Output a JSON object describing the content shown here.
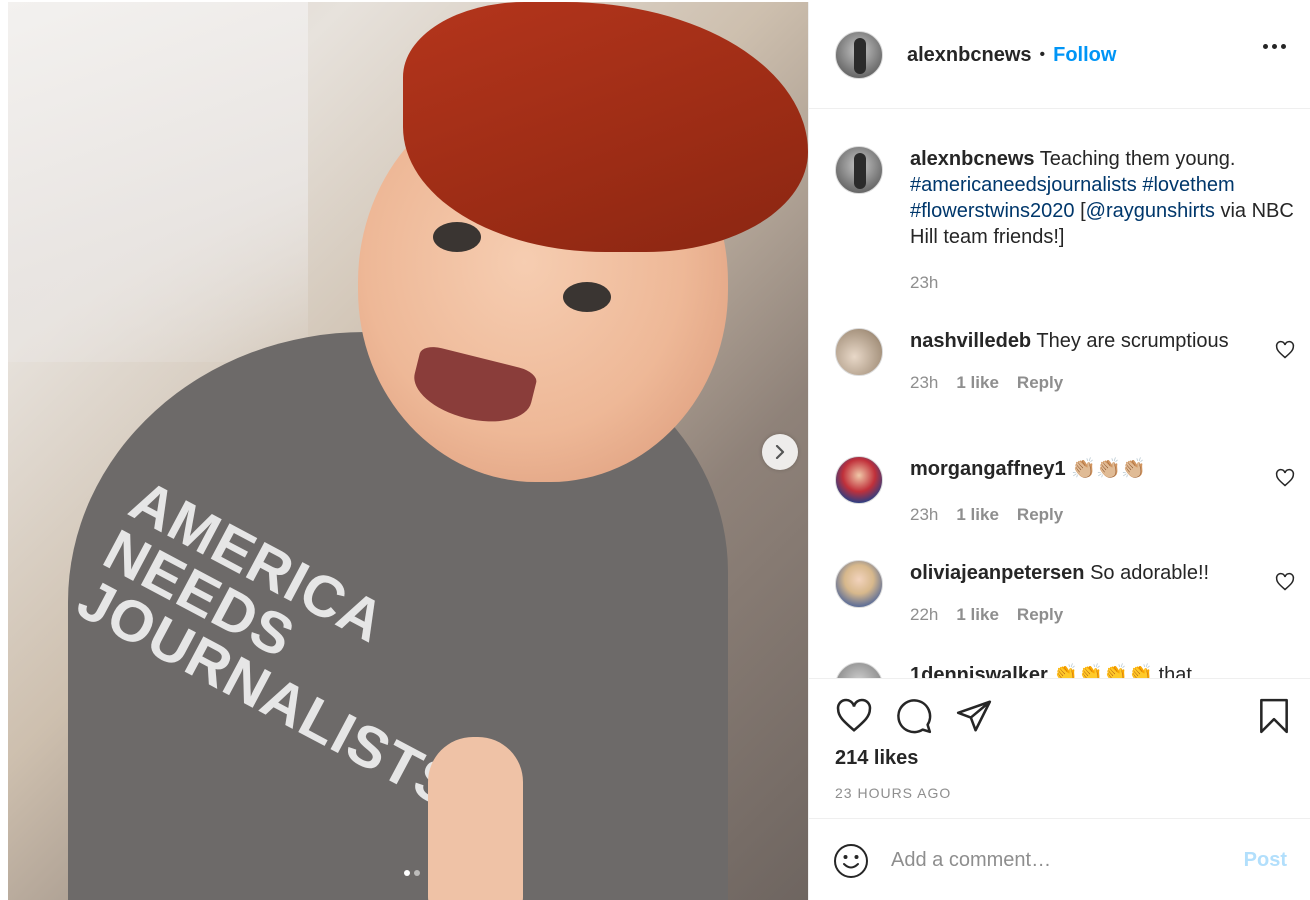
{
  "photo": {
    "shirt_print": [
      "AMERICA",
      "NEEDS",
      "JOURNALISTS"
    ],
    "carousel_dots": 2,
    "active_dot": 0
  },
  "header": {
    "username": "alexnbcnews",
    "separator": "•",
    "follow_label": "Follow"
  },
  "caption": {
    "username": "alexnbcnews",
    "text": "Teaching them young.",
    "hashtag_1": "#americaneedsjournalists",
    "hashtag_2": "#lovethem",
    "hashtag_3": "#flowerstwins2020",
    "open_bracket": "[",
    "mention": "@raygunshirts",
    "tail": "via NBC Hill team friends!]",
    "time": "23h"
  },
  "comments": [
    {
      "username": "nashvilledeb",
      "text": "They are scrumptious",
      "time": "23h",
      "likes": "1 like",
      "reply": "Reply"
    },
    {
      "username": "morgangaffney1",
      "text": "👏🏼👏🏼👏🏼",
      "time": "23h",
      "likes": "1 like",
      "reply": "Reply"
    },
    {
      "username": "oliviajeanpetersen",
      "text": "So adorable!!",
      "time": "22h",
      "likes": "1 like",
      "reply": "Reply"
    },
    {
      "username": "1denniswalker",
      "text": "👏👏👏👏 that"
    }
  ],
  "actions": {
    "likes": "214 likes",
    "time_ago": "23 HOURS AGO"
  },
  "composer": {
    "placeholder": "Add a comment…",
    "post_label": "Post"
  },
  "colors": {
    "link_blue": "#0095f6",
    "hashtag": "#00376b",
    "muted": "#8e8e8e",
    "post_disabled": "#b2dffc"
  },
  "icons": [
    "chevron-right-icon",
    "more-icon",
    "heart-icon",
    "comment-icon",
    "share-icon",
    "bookmark-icon",
    "emoji-icon"
  ]
}
